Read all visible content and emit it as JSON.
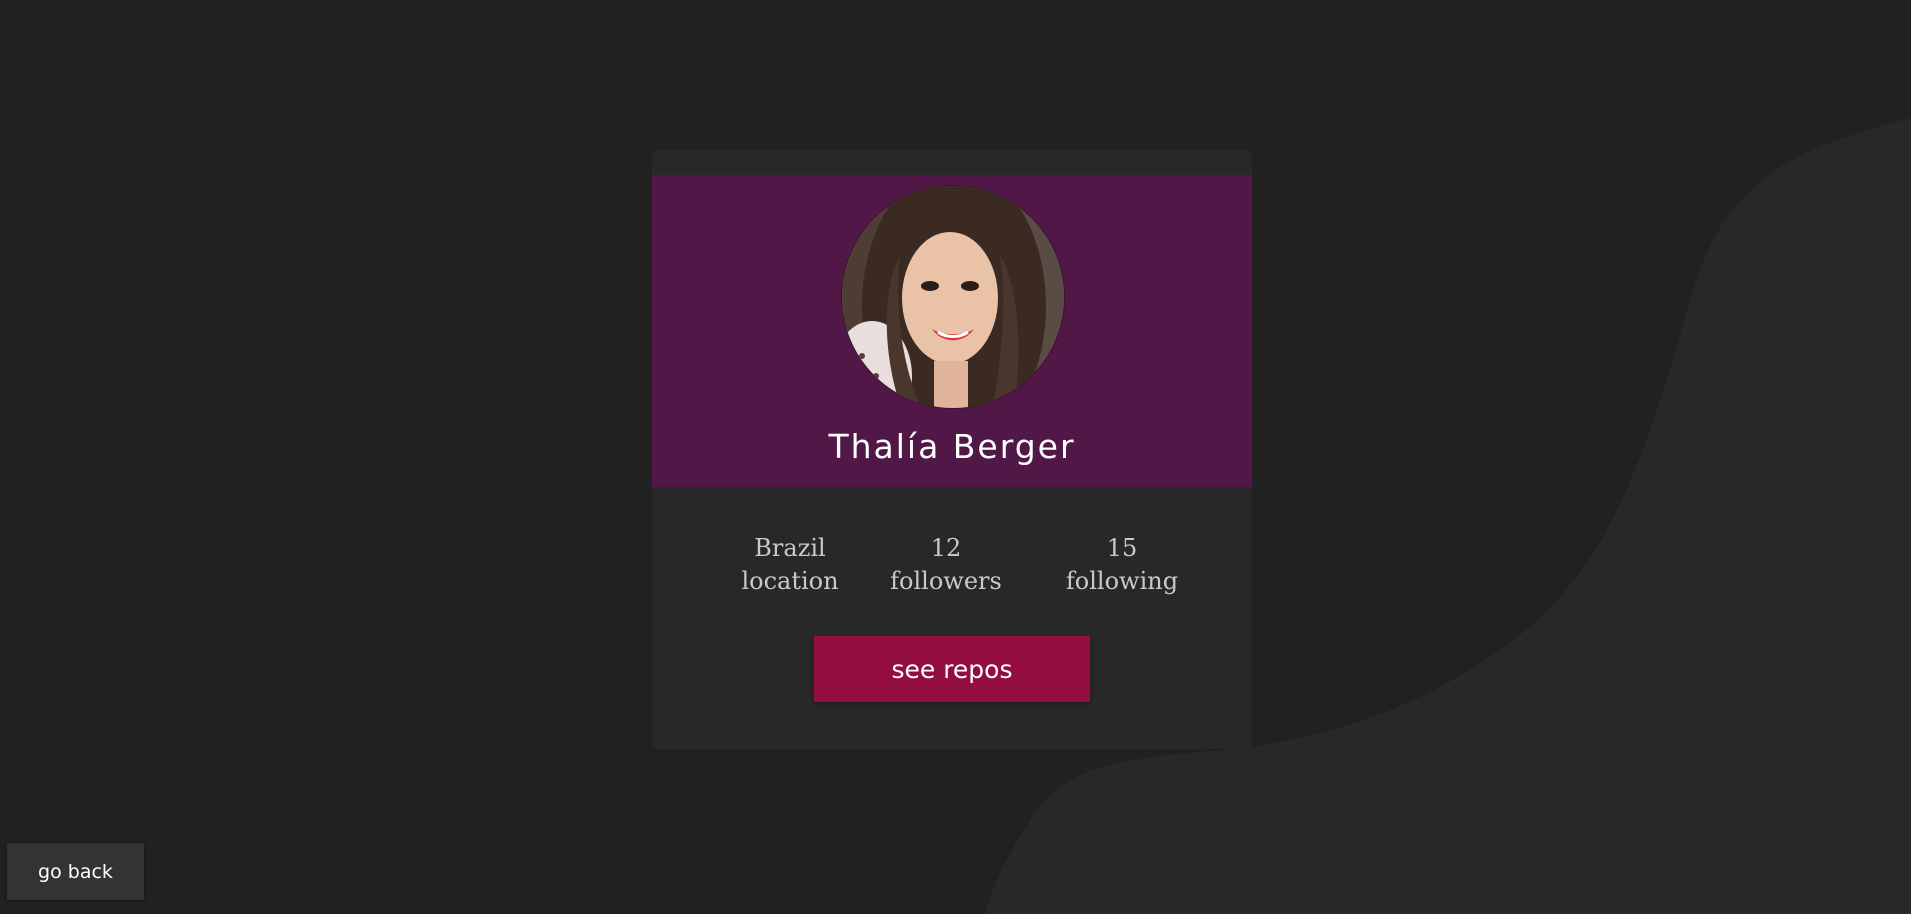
{
  "profile": {
    "name": "Thalía Berger",
    "avatar_alt": "profile photo"
  },
  "stats": {
    "location_value": "Brazil",
    "location_label": "location",
    "followers_value": "12",
    "followers_label": "followers",
    "following_value": "15",
    "following_label": "following"
  },
  "actions": {
    "repos_label": "see repos",
    "back_label": "go back"
  },
  "colors": {
    "page_bg": "#212121",
    "wave_bg": "#282828",
    "card_bg": "#282828",
    "header_bg": "#511747",
    "accent_button": "#930d3f",
    "back_button_bg": "#333333",
    "stat_text": "#c9c9c9"
  },
  "icons": {
    "avatar": "portrait-photo"
  }
}
